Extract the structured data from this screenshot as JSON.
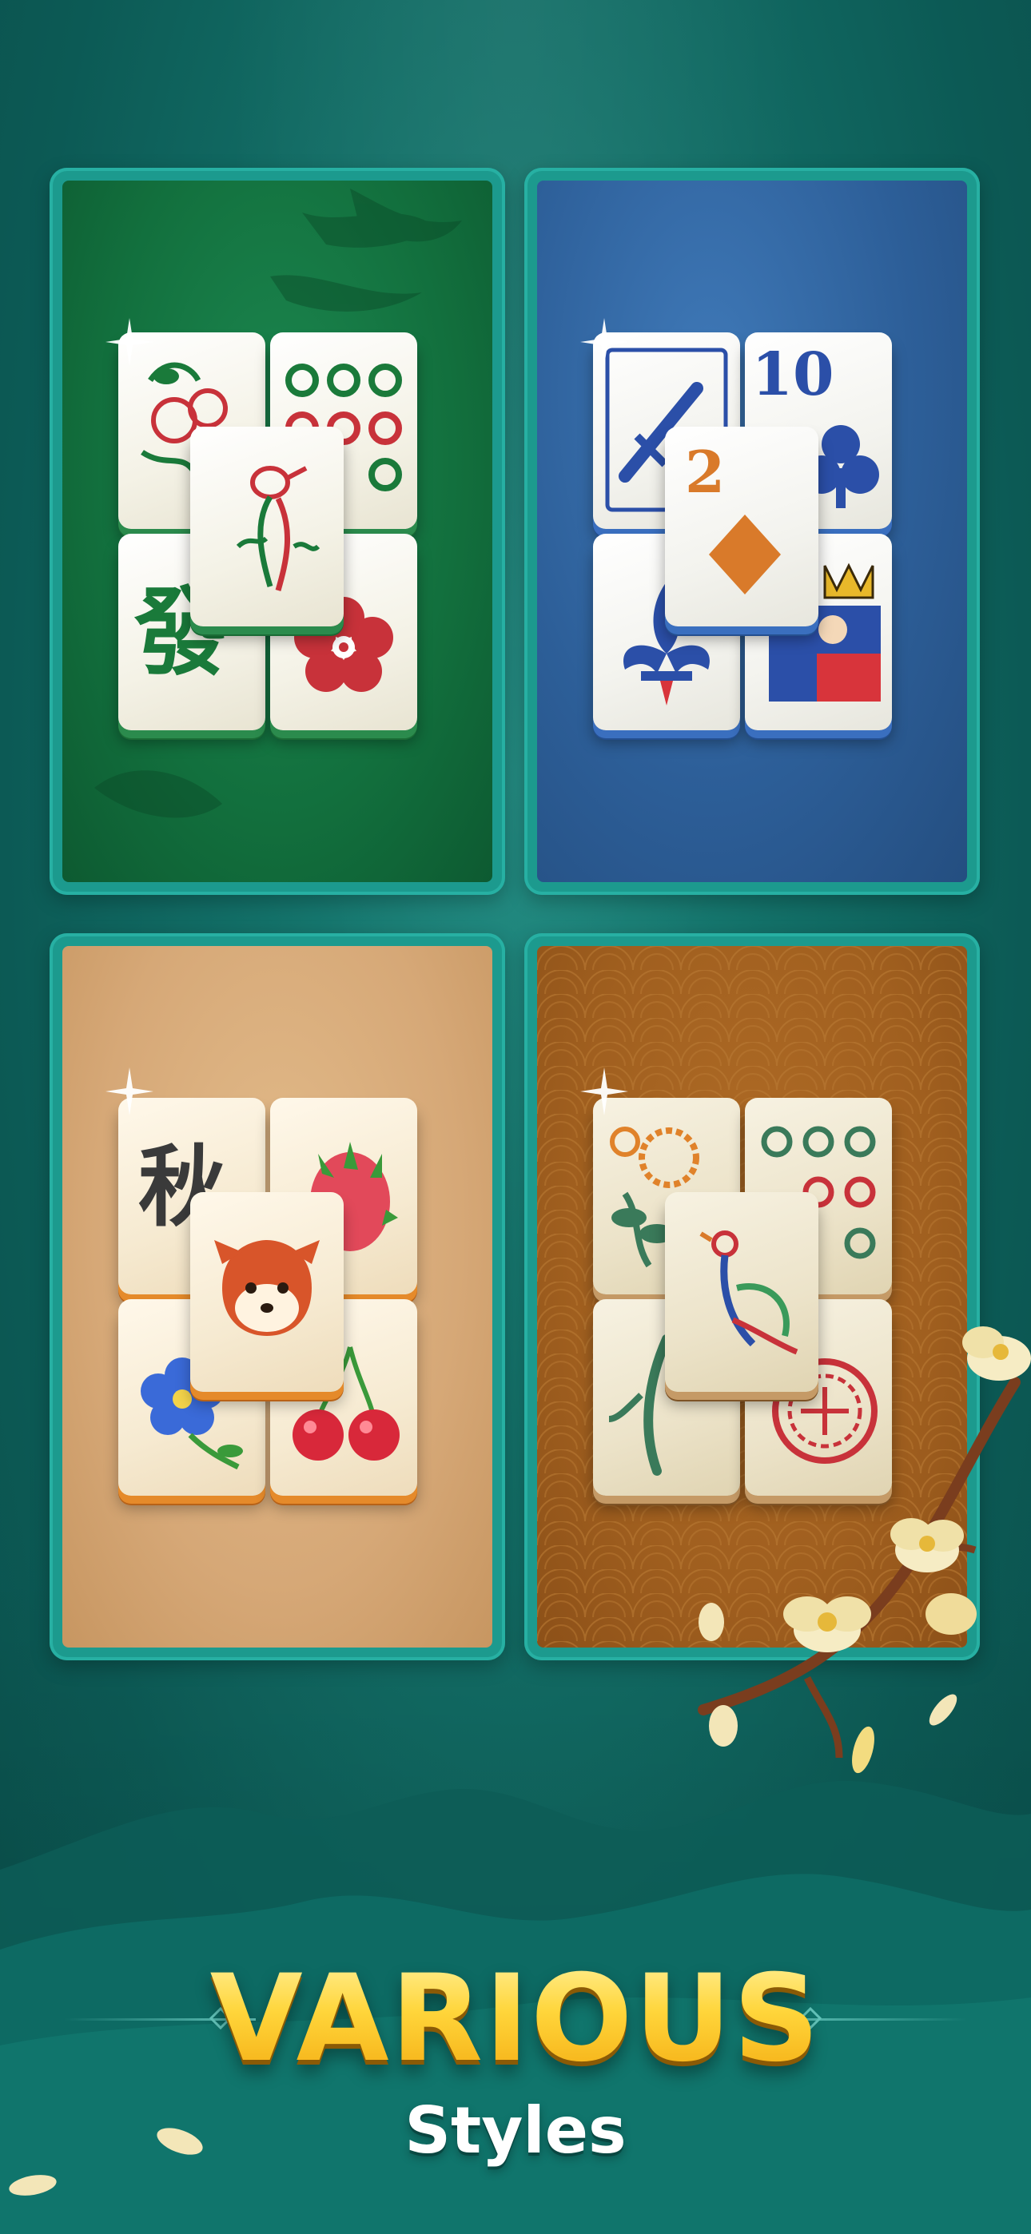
{
  "headline": {
    "main": "VARIOUS",
    "sub": "Styles"
  },
  "colors": {
    "background": "#137068",
    "panel_frame": "#1c9a8e",
    "headline_gold": "#ffd02a",
    "headline_sub": "#ffffff"
  },
  "styles": [
    {
      "name": "green",
      "theme": "classic-mahjong",
      "tiles": [
        "fruit-icon",
        "circles-icon",
        "fa-character",
        "plum-blossom-icon"
      ],
      "center": "bird-icon",
      "glyph_fa": "發"
    },
    {
      "name": "blue",
      "theme": "playing-cards",
      "tiles": [
        "sword-card-icon",
        "club-10-icon",
        "fleur-de-lis-icon",
        "king-card-icon"
      ],
      "center": "diamond-2-icon",
      "card_ten": "10",
      "card_two": "2"
    },
    {
      "name": "beige",
      "theme": "cute-fruits-animals",
      "tiles": [
        "autumn-character",
        "dragon-fruit-icon",
        "blue-flower-icon",
        "cherries-icon"
      ],
      "center": "red-panda-icon",
      "glyph_qiu": "秋"
    },
    {
      "name": "brown",
      "theme": "vintage-mahjong",
      "tiles": [
        "chrysanthemum-icon",
        "wave-circles-icon",
        "bamboo-icon",
        "red-seal-icon"
      ],
      "center": "peacock-icon"
    }
  ]
}
